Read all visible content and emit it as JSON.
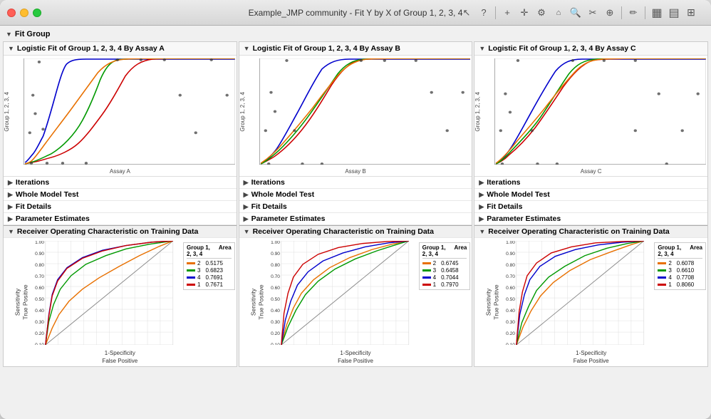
{
  "window": {
    "title": "Example_JMP community - Fit Y by X of Group 1, 2, 3, 4"
  },
  "fitGroup": {
    "label": "Fit Group"
  },
  "columns": [
    {
      "id": "assay-a",
      "header": "Logistic Fit of Group 1, 2, 3, 4 By Assay A",
      "xLabel": "Assay A",
      "xMax": 2000,
      "sections": [
        {
          "label": "Iterations"
        },
        {
          "label": "Whole Model Test"
        },
        {
          "label": "Fit Details"
        },
        {
          "label": "Parameter Estimates"
        }
      ],
      "roc": {
        "title": "Receiver Operating Characteristic on Training Data",
        "legend": [
          {
            "group": "2",
            "area": "0.5175",
            "color": "#e87000"
          },
          {
            "group": "3",
            "area": "0.6823",
            "color": "#009900"
          },
          {
            "group": "4",
            "area": "0.7691",
            "color": "#0000cc"
          },
          {
            "group": "1",
            "area": "0.7671",
            "color": "#cc0000"
          }
        ]
      }
    },
    {
      "id": "assay-b",
      "header": "Logistic Fit of Group 1, 2, 3, 4 By Assay B",
      "xLabel": "Assay B",
      "xMax": 600,
      "sections": [
        {
          "label": "Iterations"
        },
        {
          "label": "Whole Model Test"
        },
        {
          "label": "Fit Details"
        },
        {
          "label": "Parameter Estimates"
        }
      ],
      "roc": {
        "title": "Receiver Operating Characteristic on Training Data",
        "legend": [
          {
            "group": "2",
            "area": "0.6745",
            "color": "#e87000"
          },
          {
            "group": "3",
            "area": "0.6458",
            "color": "#009900"
          },
          {
            "group": "4",
            "area": "0.7044",
            "color": "#0000cc"
          },
          {
            "group": "1",
            "area": "0.7970",
            "color": "#cc0000"
          }
        ]
      }
    },
    {
      "id": "assay-c",
      "header": "Logistic Fit of Group 1, 2, 3, 4 By Assay C",
      "xLabel": "Assay C",
      "xMax": 4000,
      "sections": [
        {
          "label": "Iterations"
        },
        {
          "label": "Whole Model Test"
        },
        {
          "label": "Fit Details"
        },
        {
          "label": "Parameter Estimates"
        }
      ],
      "roc": {
        "title": "Receiver Operating Characteristic on Training Data",
        "legend": [
          {
            "group": "2",
            "area": "0.6078",
            "color": "#e87000"
          },
          {
            "group": "3",
            "area": "0.6610",
            "color": "#009900"
          },
          {
            "group": "4",
            "area": "0.7708",
            "color": "#0000cc"
          },
          {
            "group": "1",
            "area": "0.8060",
            "color": "#cc0000"
          }
        ]
      }
    }
  ],
  "toolbar": {
    "icons": [
      "↖",
      "?",
      "+",
      "✛",
      "⚙",
      "⌂",
      "🔍",
      "✂",
      "⊕",
      "✏",
      "▦",
      "▤",
      "⊞"
    ]
  },
  "yAxisLabel": "Group 1, 2, 3, 4",
  "rocXLabel1": "1-Specificity",
  "rocXLabel2": "False Positive",
  "rocYLabel1": "Sensitivity",
  "rocYLabel2": "True Positive",
  "rocLegendHeader1": "Group 1,",
  "rocLegendHeader2": "2, 3, 4",
  "rocLegendHeader3": "Area"
}
